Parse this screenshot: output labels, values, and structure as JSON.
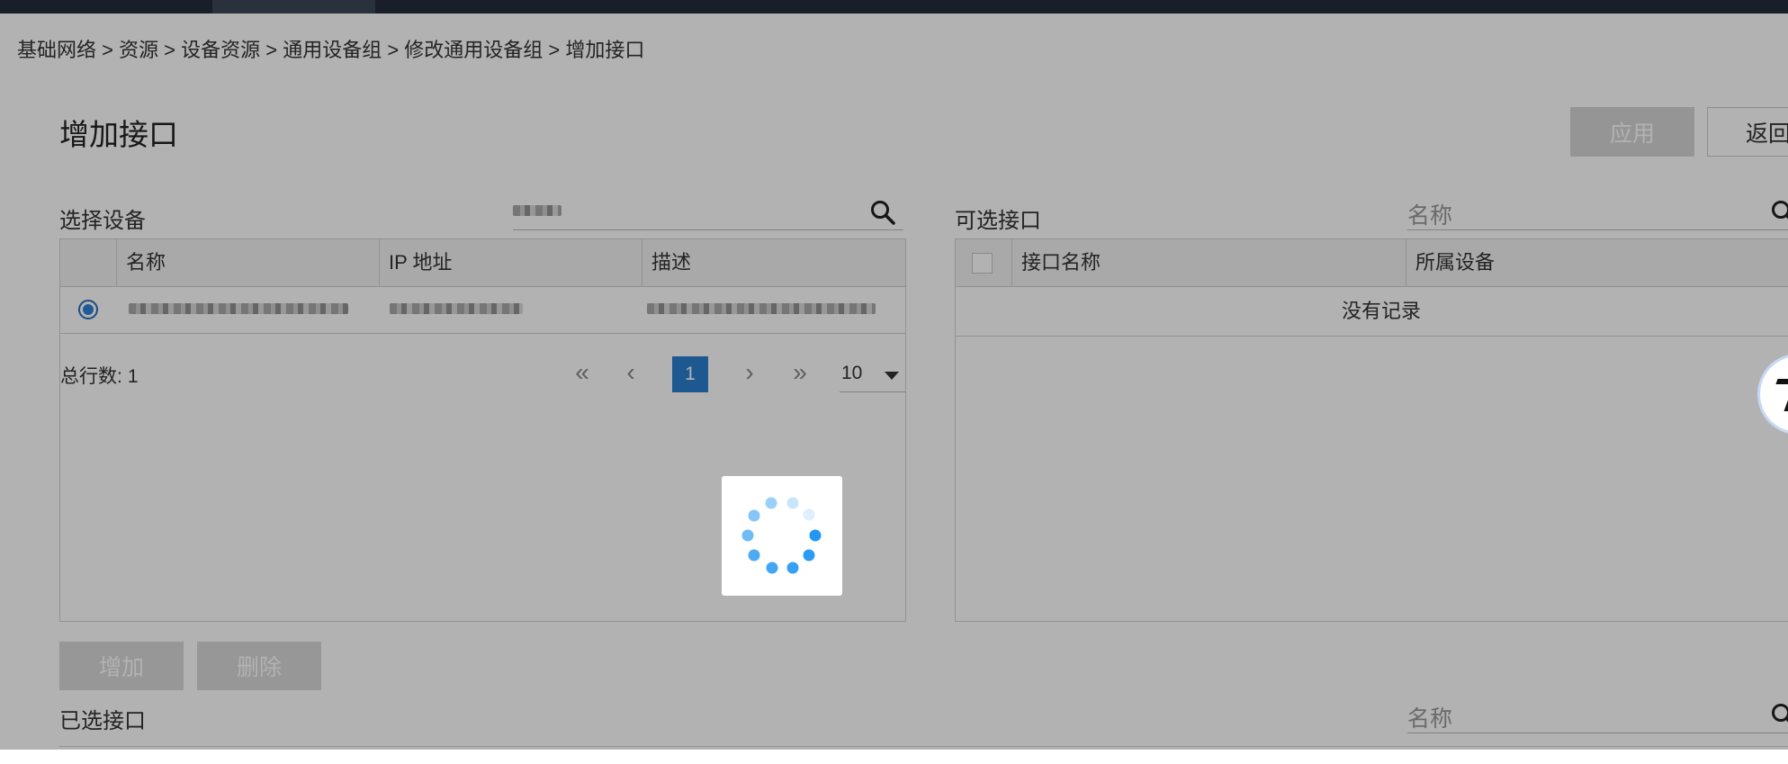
{
  "breadcrumb": {
    "text": "基础网络 > 资源 > 设备资源 > 通用设备组 > 修改通用设备组 > 增加接口"
  },
  "page": {
    "title": "增加接口",
    "apply_label": "应用",
    "back_label": "返回"
  },
  "select_device": {
    "label": "选择设备",
    "columns": [
      "名称",
      "IP 地址",
      "描述"
    ],
    "rows": [
      {
        "selected": true,
        "name": "",
        "ip": "",
        "description": ""
      }
    ],
    "total_label": "总行数:",
    "total": "1",
    "pager": {
      "first": "«",
      "prev": "‹",
      "current": "1",
      "next": "›",
      "last": "»",
      "page_size": "10"
    }
  },
  "available_interfaces": {
    "label": "可选接口",
    "search_placeholder": "名称",
    "columns": [
      "接口名称",
      "所属设备"
    ],
    "empty_text": "没有记录"
  },
  "actions": {
    "add_label": "增加",
    "delete_label": "删除"
  },
  "selected_interfaces": {
    "label": "已选接口",
    "search_placeholder": "名称"
  },
  "colors": {
    "primary": "#2b7fd0",
    "topbar": "#232d3a",
    "spinner": "#2196f3",
    "disabled_button": "#d6d6d6"
  },
  "icons": {
    "search": "search-icon",
    "spinner": "loading-spinner-icon"
  }
}
